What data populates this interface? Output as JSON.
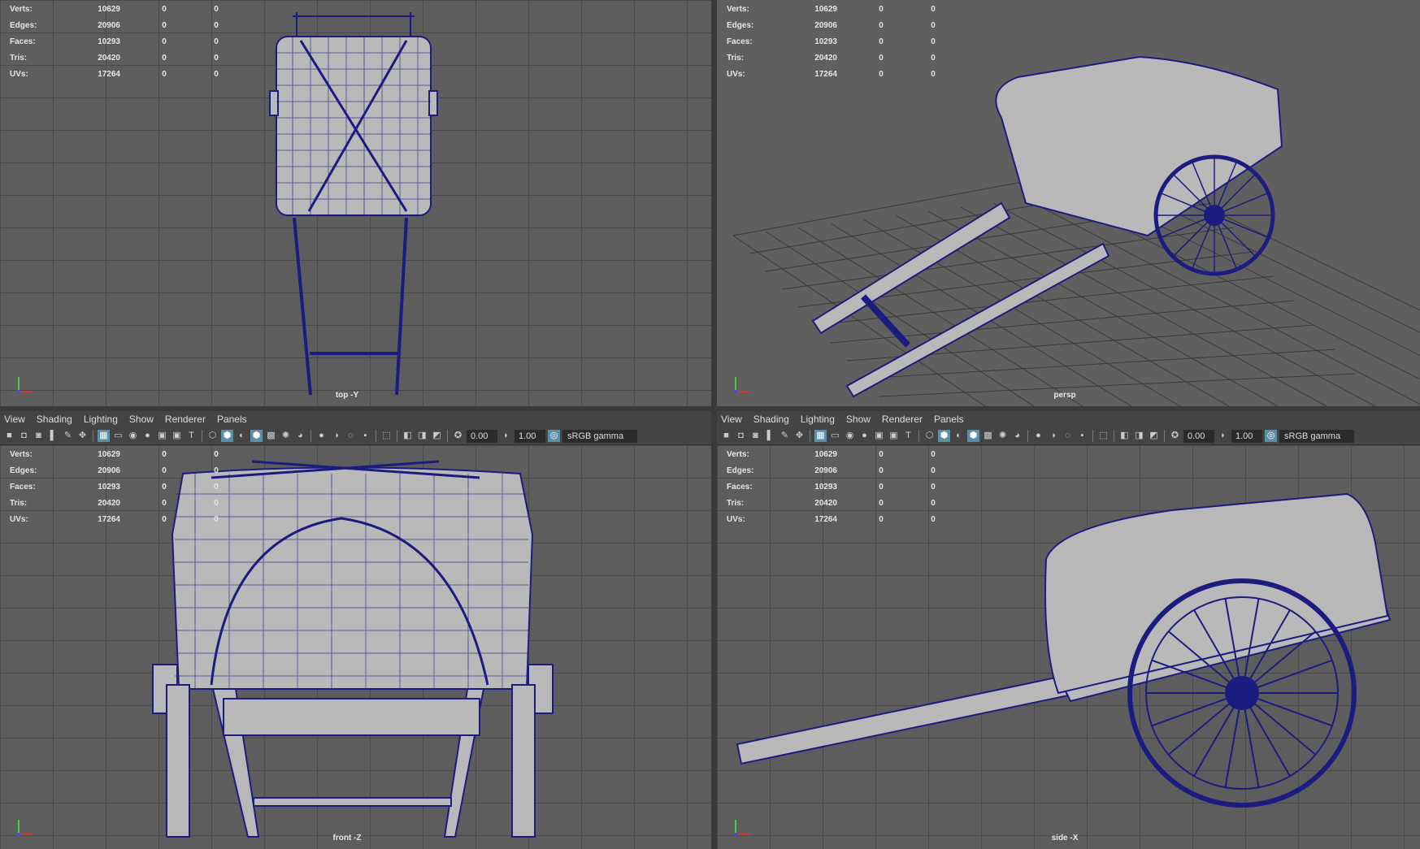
{
  "menu": [
    "View",
    "Shading",
    "Lighting",
    "Show",
    "Renderer",
    "Panels"
  ],
  "toolbar": {
    "exposure": "0.00",
    "gamma": "1.00",
    "color_space": "sRGB gamma"
  },
  "hud": {
    "labels": [
      "Verts:",
      "Edges:",
      "Faces:",
      "Tris:",
      "UVs:"
    ],
    "values": [
      "10629",
      "20906",
      "10293",
      "20420",
      "17264"
    ],
    "col2": "0",
    "col3": "0"
  },
  "viewports": [
    {
      "camera": "top -Y"
    },
    {
      "camera": "persp"
    },
    {
      "camera": "front -Z"
    },
    {
      "camera": "side -X"
    }
  ],
  "colors": {
    "wire": "#1a1a7a",
    "surface": "#b8b8b8",
    "grid": "#4a4a4a",
    "bg": "#5d5d5d",
    "active": "#5b8fa8"
  }
}
